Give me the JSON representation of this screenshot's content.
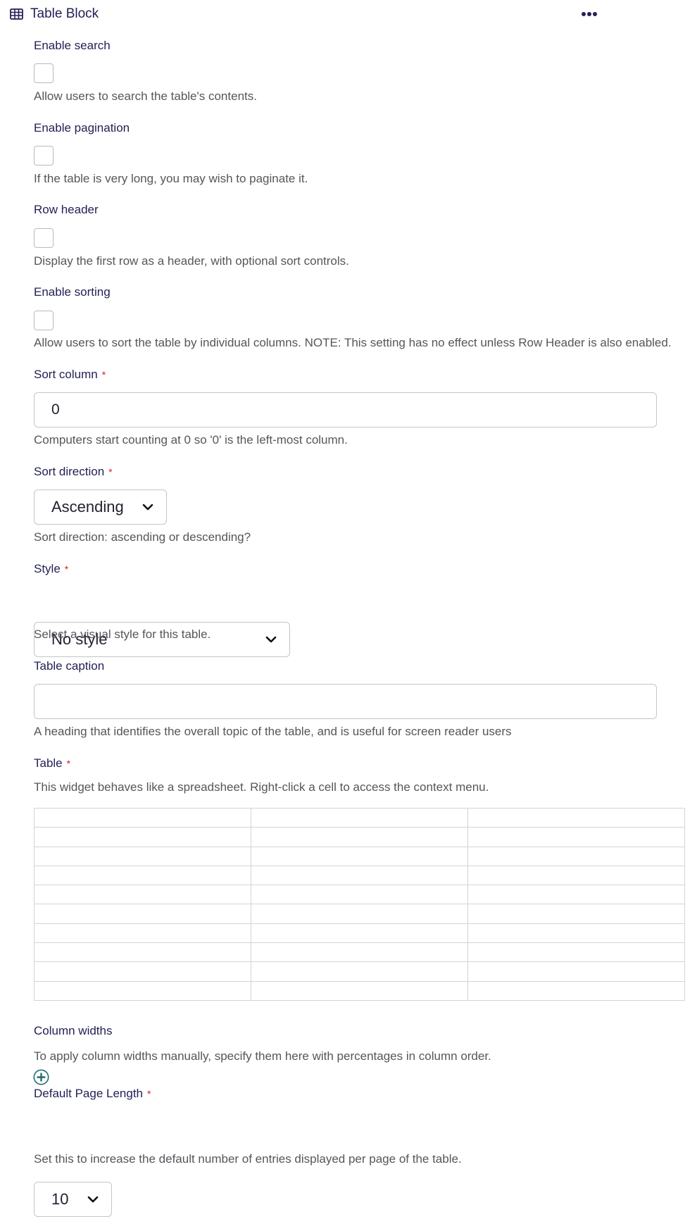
{
  "header": {
    "icon": "table-icon",
    "title": "Table Block",
    "menu_icon": "more-horizontal-icon"
  },
  "fields": {
    "enable_search": {
      "label": "Enable search",
      "checked": false,
      "description": "Allow users to search the table's contents."
    },
    "enable_pagination": {
      "label": "Enable pagination",
      "checked": false,
      "description": "If the table is very long, you may wish to paginate it."
    },
    "row_header": {
      "label": "Row header",
      "checked": false,
      "description": "Display the first row as a header, with optional sort controls."
    },
    "enable_sorting": {
      "label": "Enable sorting",
      "checked": false,
      "description": "Allow users to sort the table by individual columns. NOTE: This setting has no effect unless Row Header is also enabled."
    },
    "sort_column": {
      "label": "Sort column",
      "required_mark": "*",
      "value": "0",
      "description": "Computers start counting at 0 so '0' is the left-most column."
    },
    "sort_direction": {
      "label": "Sort direction",
      "required_mark": "*",
      "selected": "Ascending",
      "description": "Sort direction: ascending or descending?"
    },
    "style": {
      "label": "Style",
      "required_mark": "*",
      "selected": "No style",
      "description": "Select a visual style for this table."
    },
    "table_caption": {
      "label": "Table caption",
      "value": "",
      "description": "A heading that identifies the overall topic of the table, and is useful for screen reader users"
    },
    "table": {
      "label": "Table",
      "required_mark": "*",
      "description": "This widget behaves like a spreadsheet. Right-click a cell to access the context menu.",
      "rows": [
        [
          "",
          "",
          ""
        ],
        [
          "",
          "",
          ""
        ],
        [
          "",
          "",
          ""
        ],
        [
          "",
          "",
          ""
        ],
        [
          "",
          "",
          ""
        ],
        [
          "",
          "",
          ""
        ],
        [
          "",
          "",
          ""
        ],
        [
          "",
          "",
          ""
        ],
        [
          "",
          "",
          ""
        ],
        [
          "",
          "",
          ""
        ]
      ]
    },
    "column_widths": {
      "label": "Column widths",
      "description": "To apply column widths manually, specify them here with percentages in column order.",
      "add_icon": "add-circle-icon"
    },
    "default_page_length": {
      "label": "Default Page Length",
      "required_mark": "*",
      "selected": "10",
      "description": "Set this to increase the default number of entries displayed per page of the table."
    }
  },
  "colors": {
    "label": "#232156",
    "description": "#55565b",
    "required": "#d72222",
    "add_icon": "#1f6e6a",
    "border": "#c4c5ca"
  }
}
